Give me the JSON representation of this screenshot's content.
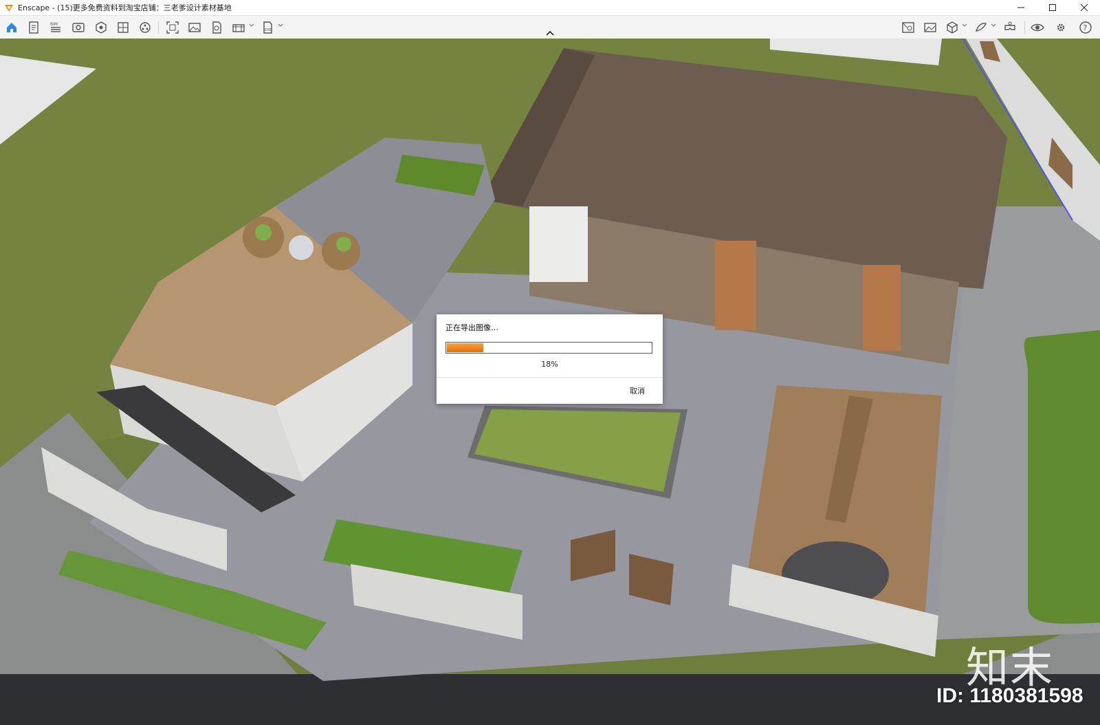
{
  "window": {
    "title": "Enscape - (15)更多免费资料到淘宝店铺：三老爹设计素材基地",
    "controls": [
      "minimize-icon",
      "maximize-icon",
      "close-icon"
    ]
  },
  "toolbar": {
    "left_icons": [
      "home-icon",
      "document-icon",
      "bim-icon",
      "visual-settings-icon",
      "view-management-icon",
      "views-icon",
      "asset-library-icon",
      "screenshot-icon",
      "image-icon",
      "panorama-icon",
      "batch-render-icon",
      "export-exe-icon"
    ],
    "right_icons": [
      "material-editor-icon",
      "render-image-icon",
      "cube-view-icon",
      "material-icon",
      "vr-headset-icon",
      "eye-icon",
      "settings-icon",
      "help-icon"
    ],
    "bim_label": "BIM",
    "exe_label": "EXE"
  },
  "dialog": {
    "title": "正在导出图像…",
    "progress_percent": 18,
    "progress_text": "18%",
    "cancel_label": "取消",
    "accent": "#e8820a"
  },
  "watermark": {
    "brand": "知末",
    "id_text": "ID: 1180381598"
  },
  "colors": {
    "grass": "#6b7f3a",
    "roof": "#6e5a4c",
    "deck": "#a58a6a",
    "paving": "#8f8f95"
  }
}
